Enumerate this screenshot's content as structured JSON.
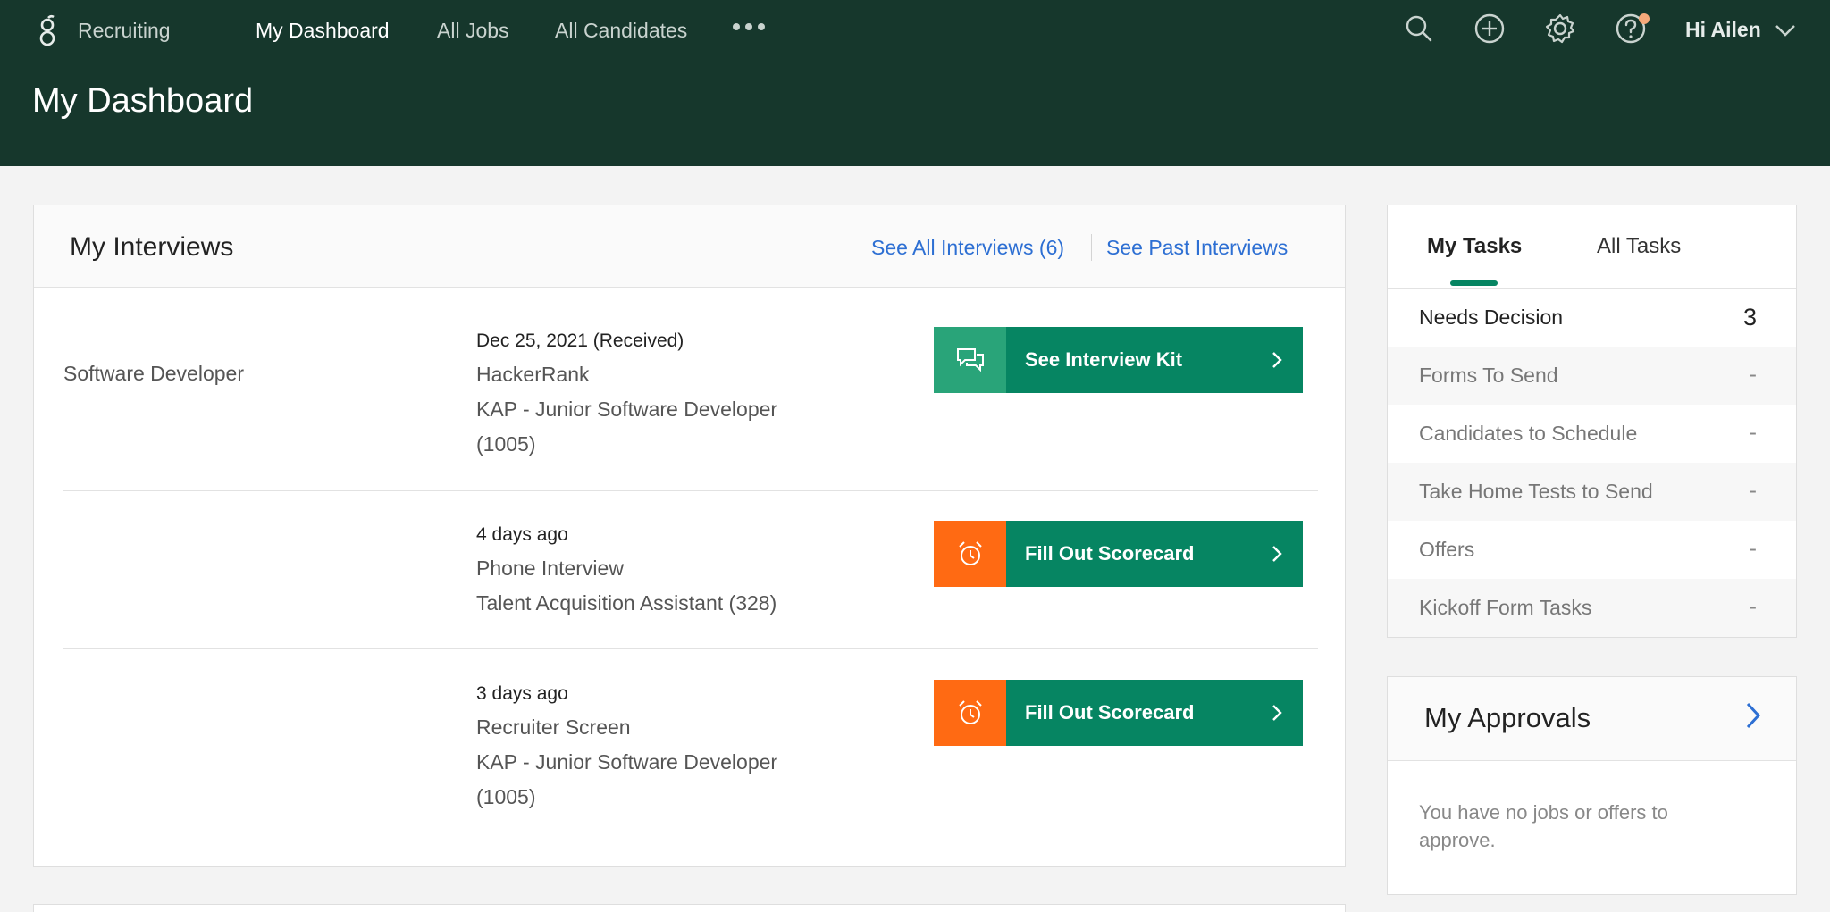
{
  "header": {
    "brand": "Recruiting",
    "nav": [
      {
        "label": "My Dashboard",
        "active": true
      },
      {
        "label": "All Jobs",
        "active": false
      },
      {
        "label": "All Candidates",
        "active": false
      }
    ],
    "icons": [
      "search-icon",
      "add-icon",
      "settings-icon",
      "help-icon"
    ],
    "greeting": "Hi Ailen",
    "page_title": "My Dashboard"
  },
  "interviews": {
    "title": "My Interviews",
    "see_all": "See All Interviews (6)",
    "see_past": "See Past Interviews",
    "rows": [
      {
        "job": "Software Developer",
        "when": "Dec 25, 2021 (Received)",
        "stage": "HackerRank",
        "position_line1": "KAP - Junior Software Developer",
        "position_line2": "(1005)",
        "action": "See Interview Kit",
        "action_icon": "chat-icon"
      },
      {
        "job": "",
        "when": "4 days ago",
        "stage": "Phone Interview",
        "position_line1": "Talent Acquisition Assistant (328)",
        "position_line2": "",
        "action": "Fill Out Scorecard",
        "action_icon": "alarm-clock-icon"
      },
      {
        "job": "",
        "when": "3 days ago",
        "stage": "Recruiter Screen",
        "position_line1": "KAP - Junior Software Developer",
        "position_line2": "(1005)",
        "action": "Fill Out Scorecard",
        "action_icon": "alarm-clock-icon"
      }
    ]
  },
  "tasks": {
    "tabs": [
      "My Tasks",
      "All Tasks"
    ],
    "items": [
      {
        "label": "Needs Decision",
        "count": "3"
      },
      {
        "label": "Forms To Send",
        "count": "-"
      },
      {
        "label": "Candidates to Schedule",
        "count": "-"
      },
      {
        "label": "Take Home Tests to Send",
        "count": "-"
      },
      {
        "label": "Offers",
        "count": "-"
      },
      {
        "label": "Kickoff Form Tasks",
        "count": "-"
      }
    ]
  },
  "approvals": {
    "title": "My Approvals",
    "empty_text": "You have no jobs or offers to approve."
  },
  "colors": {
    "header_bg": "#16372c",
    "accent_green": "#068562",
    "icon_green": "#29a479",
    "alert_orange": "#ff6a13",
    "link_blue": "#2d6fd3"
  }
}
